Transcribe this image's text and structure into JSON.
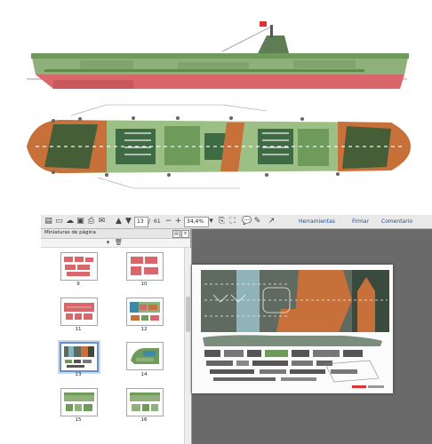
{
  "toolbar": {
    "page_current": "13",
    "page_separator": "/",
    "page_total": "61",
    "zoom": "34,4%",
    "tools_label": "Herramientas",
    "sign_label": "Firmar",
    "comment_label": "Comentario"
  },
  "panel": {
    "title": "Miniaturas de página"
  },
  "thumbnails": [
    {
      "label": "9"
    },
    {
      "label": "10"
    },
    {
      "label": "11"
    },
    {
      "label": "12"
    },
    {
      "label": "13",
      "selected": true
    },
    {
      "label": "14"
    },
    {
      "label": "15"
    },
    {
      "label": "16"
    }
  ],
  "colors": {
    "hull_green": "#8fb07a",
    "hull_red": "#d9666a",
    "deck_brown": "#c8703a",
    "deck_green": "#6e9a5a",
    "dark_green": "#2f5a37",
    "selection": "#6a8fc7"
  }
}
